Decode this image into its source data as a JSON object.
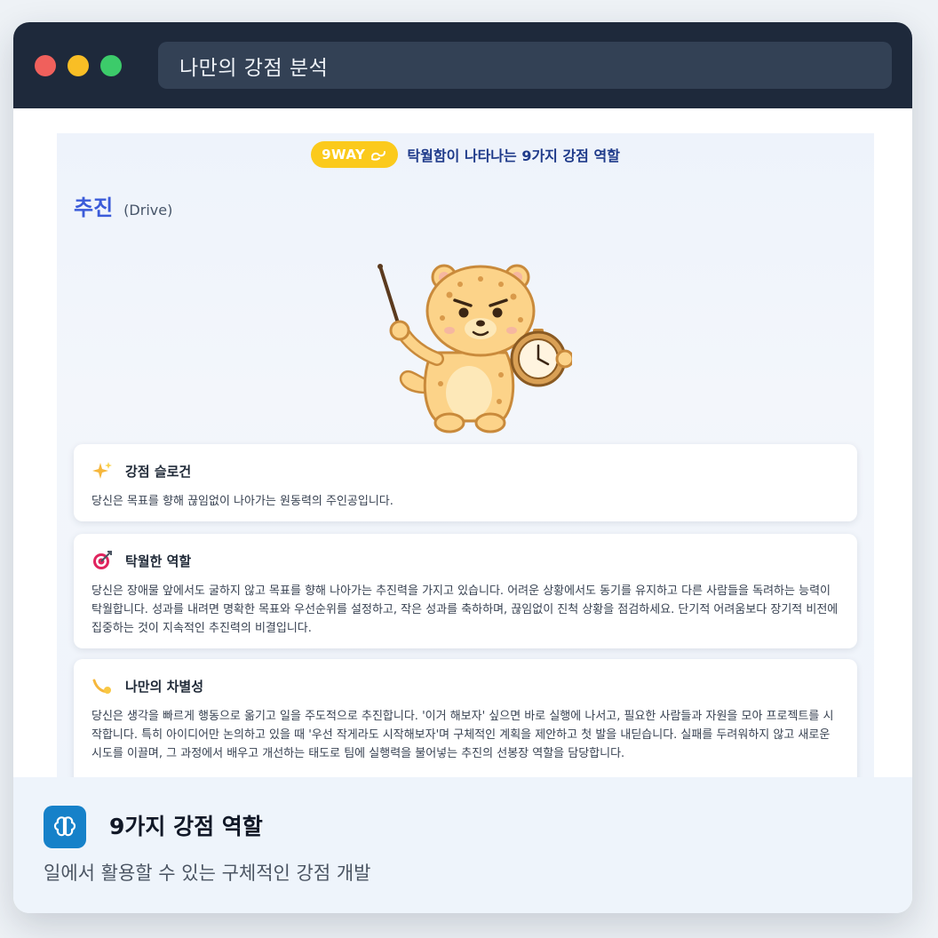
{
  "window": {
    "title": "나만의 강점 분석"
  },
  "header": {
    "badge_label": "9WAY",
    "badge_icon": "link-icon",
    "title": "탁월함이 나타나는 9가지 강점 역할"
  },
  "role": {
    "name": "추진",
    "english": "(Drive)"
  },
  "cards": [
    {
      "icon": "sparkles-icon",
      "title": "강점 슬로건",
      "body": "당신은 목표를 향해 끊임없이 나아가는 원동력의 주인공입니다."
    },
    {
      "icon": "target-icon",
      "title": "탁월한 역할",
      "body": "당신은 장애물 앞에서도 굴하지 않고 목표를 향해 나아가는 추진력을 가지고 있습니다. 어려운 상황에서도 동기를 유지하고 다른 사람들을 독려하는 능력이 탁월합니다. 성과를 내려면 명확한 목표와 우선순위를 설정하고, 작은 성과를 축하하며, 끊임없이 진척 상황을 점검하세요. 단기적 어려움보다 장기적 비전에 집중하는 것이 지속적인 추진력의 비결입니다."
    },
    {
      "icon": "comet-icon",
      "title": "나만의 차별성",
      "body": "당신은 생각을 빠르게 행동으로 옮기고 일을 주도적으로 추진합니다. '이거 해보자' 싶으면 바로 실행에 나서고, 필요한 사람들과 자원을 모아 프로젝트를 시작합니다. 특히 아이디어만 논의하고 있을 때 '우선 작게라도 시작해보자'며 구체적인 계획을 제안하고 첫 발을 내딛습니다. 실패를 두려워하지 않고 새로운 시도를 이끌며, 그 과정에서 배우고 개선하는 태도로 팀에 실행력을 불어넣는 추진의 선봉장 역할을 담당합니다."
    }
  ],
  "footer": {
    "icon": "brain-icon",
    "title": "9가지 강점 역할",
    "subtitle": "일에서 활용할 수 있는 구체적인 강점 개발"
  },
  "colors": {
    "titlebar": "#1e293b",
    "badge": "#fbca1c",
    "role_accent": "#3b5bd9",
    "footer_icon_bg": "#1681c9"
  }
}
